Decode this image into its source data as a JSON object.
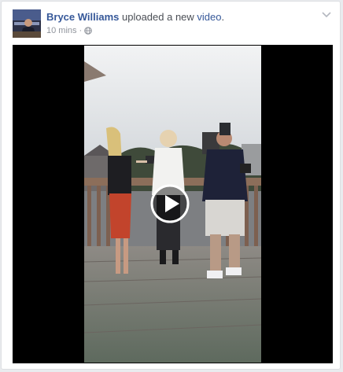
{
  "post": {
    "actor_name": "Bryce Williams",
    "action_text": " uploaded a new ",
    "object_link": "video",
    "period": ".",
    "timestamp": "10 mins",
    "separator": "·",
    "privacy_icon": "globe-icon",
    "menu_icon": "chevron-down-icon"
  },
  "video": {
    "play_icon": "play-icon"
  },
  "colors": {
    "link": "#365899",
    "meta": "#90949c",
    "background": "#e9ebee"
  }
}
